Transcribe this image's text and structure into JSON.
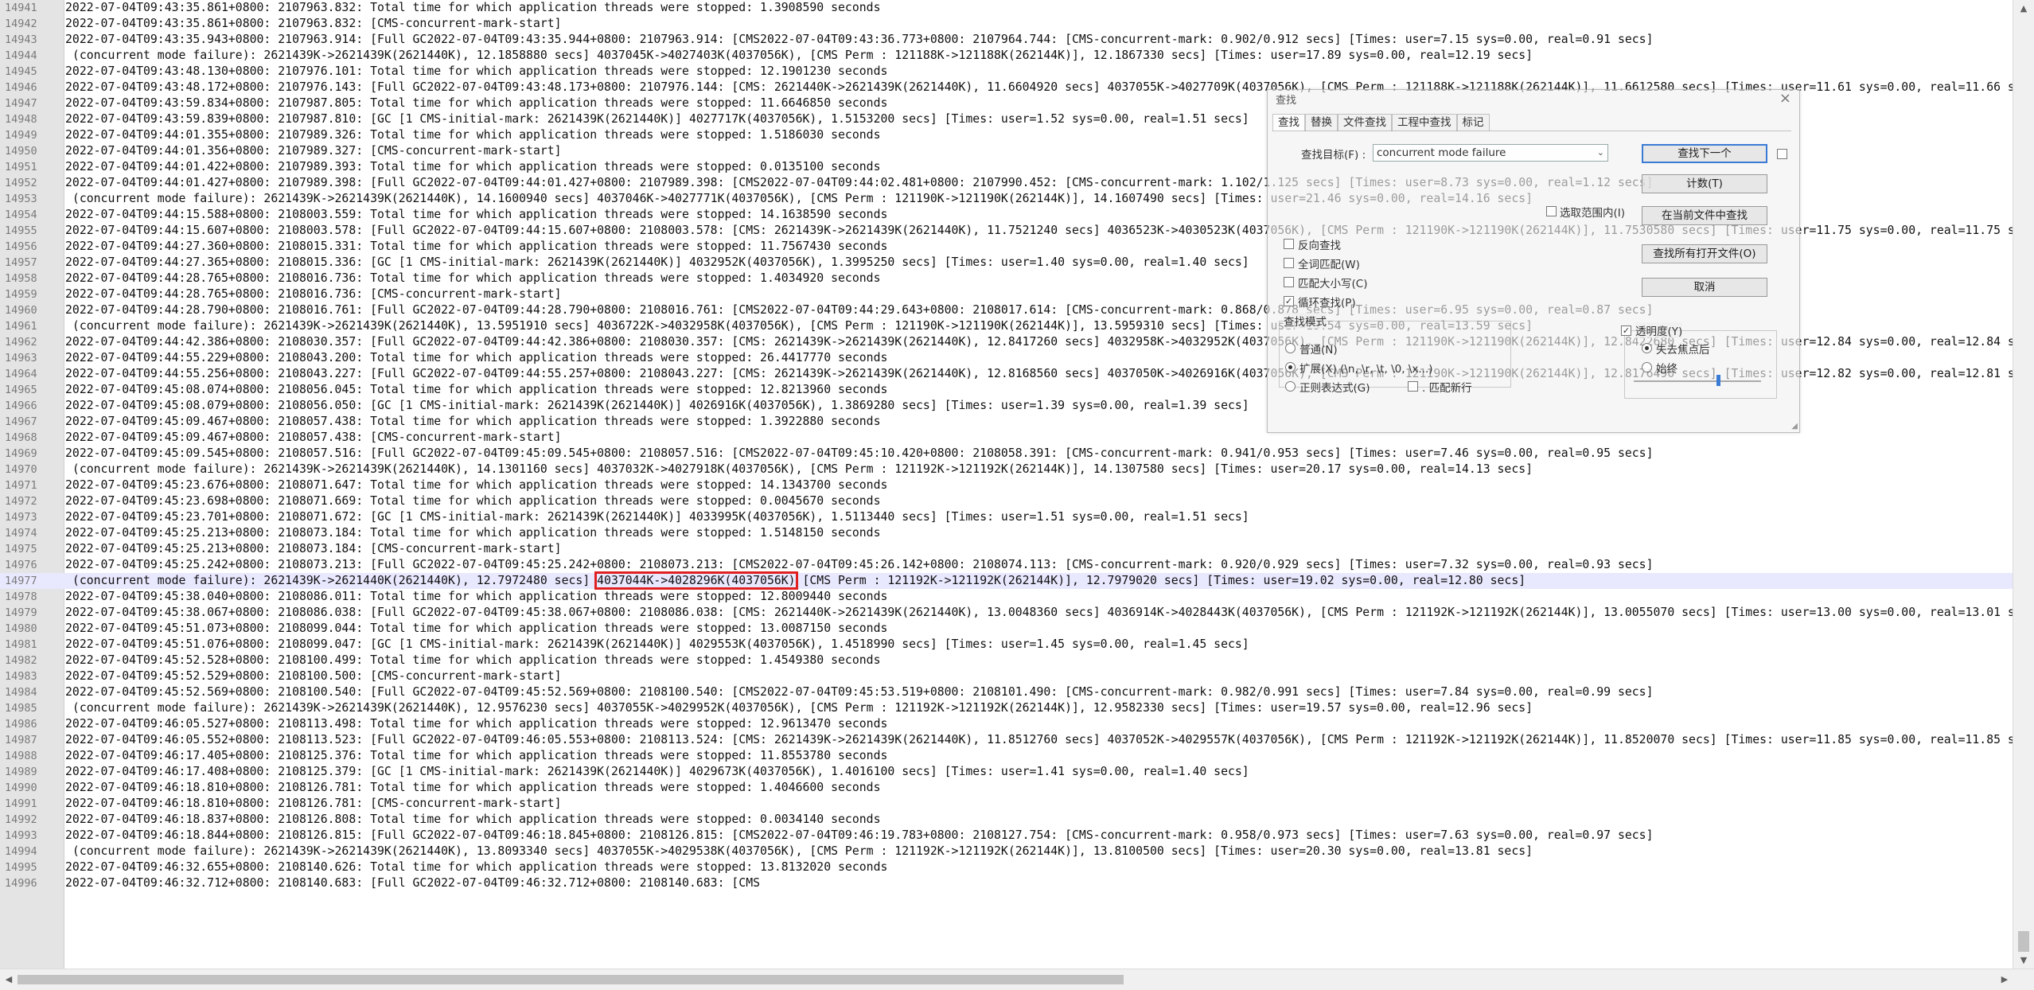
{
  "editor": {
    "highlight_text": "4037044K->4028296K(4037056K)",
    "current_line": "14977",
    "lines": [
      {
        "n": "14941",
        "t": "2022-07-04T09:43:35.861+0800: 2107963.832: Total time for which application threads were stopped: 1.3908590 seconds"
      },
      {
        "n": "14942",
        "t": "2022-07-04T09:43:35.861+0800: 2107963.832: [CMS-concurrent-mark-start]"
      },
      {
        "n": "14943",
        "t": "2022-07-04T09:43:35.943+0800: 2107963.914: [Full GC2022-07-04T09:43:35.944+0800: 2107963.914: [CMS2022-07-04T09:43:36.773+0800: 2107964.744: [CMS-concurrent-mark: 0.902/0.912 secs] [Times: user=7.15 sys=0.00, real=0.91 secs]"
      },
      {
        "n": "14944",
        "t": " (concurrent mode failure): 2621439K->2621439K(2621440K), 12.1858880 secs] 4037045K->4027403K(4037056K), [CMS Perm : 121188K->121188K(262144K)], 12.1867330 secs] [Times: user=17.89 sys=0.00, real=12.19 secs]"
      },
      {
        "n": "14945",
        "t": "2022-07-04T09:43:48.130+0800: 2107976.101: Total time for which application threads were stopped: 12.1901230 seconds"
      },
      {
        "n": "14946",
        "t": "2022-07-04T09:43:48.172+0800: 2107976.143: [Full GC2022-07-04T09:43:48.173+0800: 2107976.144: [CMS: 2621440K->2621439K(2621440K), 11.6604920 secs] 4037055K->4027709K(4037056K), [CMS Perm : 121188K->121188K(262144K)], 11.6612580 secs] [Times: user=11.61 sys=0.00, real=11.66 secs]"
      },
      {
        "n": "14947",
        "t": "2022-07-04T09:43:59.834+0800: 2107987.805: Total time for which application threads were stopped: 11.6646850 seconds"
      },
      {
        "n": "14948",
        "t": "2022-07-04T09:43:59.839+0800: 2107987.810: [GC [1 CMS-initial-mark: 2621439K(2621440K)] 4027717K(4037056K), 1.5153200 secs] [Times: user=1.52 sys=0.00, real=1.51 secs]"
      },
      {
        "n": "14949",
        "t": "2022-07-04T09:44:01.355+0800: 2107989.326: Total time for which application threads were stopped: 1.5186030 seconds"
      },
      {
        "n": "14950",
        "t": "2022-07-04T09:44:01.356+0800: 2107989.327: [CMS-concurrent-mark-start]"
      },
      {
        "n": "14951",
        "t": "2022-07-04T09:44:01.422+0800: 2107989.393: Total time for which application threads were stopped: 0.0135100 seconds"
      },
      {
        "n": "14952",
        "t": "2022-07-04T09:44:01.427+0800: 2107989.398: [Full GC2022-07-04T09:44:01.427+0800: 2107989.398: [CMS2022-07-04T09:44:02.481+0800: 2107990.452: [CMS-concurrent-mark: 1.102/1.125 secs] [Times: user=8.73 sys=0.00, real=1.12 secs]"
      },
      {
        "n": "14953",
        "t": " (concurrent mode failure): 2621439K->2621439K(2621440K), 14.1600940 secs] 4037046K->4027771K(4037056K), [CMS Perm : 121190K->121190K(262144K)], 14.1607490 secs] [Times: user=21.46 sys=0.00, real=14.16 secs]"
      },
      {
        "n": "14954",
        "t": "2022-07-04T09:44:15.588+0800: 2108003.559: Total time for which application threads were stopped: 14.1638590 seconds"
      },
      {
        "n": "14955",
        "t": "2022-07-04T09:44:15.607+0800: 2108003.578: [Full GC2022-07-04T09:44:15.607+0800: 2108003.578: [CMS: 2621439K->2621439K(2621440K), 11.7521240 secs] 4036523K->4030523K(4037056K), [CMS Perm : 121190K->121190K(262144K)], 11.7530580 secs] [Times: user=11.75 sys=0.00, real=11.75 secs]"
      },
      {
        "n": "14956",
        "t": "2022-07-04T09:44:27.360+0800: 2108015.331: Total time for which application threads were stopped: 11.7567430 seconds"
      },
      {
        "n": "14957",
        "t": "2022-07-04T09:44:27.365+0800: 2108015.336: [GC [1 CMS-initial-mark: 2621439K(2621440K)] 4032952K(4037056K), 1.3995250 secs] [Times: user=1.40 sys=0.00, real=1.40 secs]"
      },
      {
        "n": "14958",
        "t": "2022-07-04T09:44:28.765+0800: 2108016.736: Total time for which application threads were stopped: 1.4034920 seconds"
      },
      {
        "n": "14959",
        "t": "2022-07-04T09:44:28.765+0800: 2108016.736: [CMS-concurrent-mark-start]"
      },
      {
        "n": "14960",
        "t": "2022-07-04T09:44:28.790+0800: 2108016.761: [Full GC2022-07-04T09:44:28.790+0800: 2108016.761: [CMS2022-07-04T09:44:29.643+0800: 2108017.614: [CMS-concurrent-mark: 0.868/0.878 secs] [Times: user=6.95 sys=0.00, real=0.87 secs]"
      },
      {
        "n": "14961",
        "t": " (concurrent mode failure): 2621439K->2621439K(2621440K), 13.5951910 secs] 4036722K->4032958K(4037056K), [CMS Perm : 121190K->121190K(262144K)], 13.5959310 secs] [Times: user=19.54 sys=0.00, real=13.59 secs]"
      },
      {
        "n": "14962",
        "t": "2022-07-04T09:44:42.386+0800: 2108030.357: [Full GC2022-07-04T09:44:42.386+0800: 2108030.357: [CMS: 2621439K->2621439K(2621440K), 12.8417260 secs] 4032958K->4032952K(4037056K), [CMS Perm : 121190K->121190K(262144K)], 12.8422680 secs] [Times: user=12.84 sys=0.00, real=12.84 secs]"
      },
      {
        "n": "14963",
        "t": "2022-07-04T09:44:55.229+0800: 2108043.200: Total time for which application threads were stopped: 26.4417770 seconds"
      },
      {
        "n": "14964",
        "t": "2022-07-04T09:44:55.256+0800: 2108043.227: [Full GC2022-07-04T09:44:55.257+0800: 2108043.227: [CMS: 2621439K->2621439K(2621440K), 12.8168560 secs] 4037050K->4026916K(4037056K), [CMS Perm : 121190K->121190K(262144K)], 12.8176490 secs] [Times: user=12.82 sys=0.00, real=12.81 secs]"
      },
      {
        "n": "14965",
        "t": "2022-07-04T09:45:08.074+0800: 2108056.045: Total time for which application threads were stopped: 12.8213960 seconds"
      },
      {
        "n": "14966",
        "t": "2022-07-04T09:45:08.079+0800: 2108056.050: [GC [1 CMS-initial-mark: 2621439K(2621440K)] 4026916K(4037056K), 1.3869280 secs] [Times: user=1.39 sys=0.00, real=1.39 secs]"
      },
      {
        "n": "14967",
        "t": "2022-07-04T09:45:09.467+0800: 2108057.438: Total time for which application threads were stopped: 1.3922880 seconds"
      },
      {
        "n": "14968",
        "t": "2022-07-04T09:45:09.467+0800: 2108057.438: [CMS-concurrent-mark-start]"
      },
      {
        "n": "14969",
        "t": "2022-07-04T09:45:09.545+0800: 2108057.516: [Full GC2022-07-04T09:45:09.545+0800: 2108057.516: [CMS2022-07-04T09:45:10.420+0800: 2108058.391: [CMS-concurrent-mark: 0.941/0.953 secs] [Times: user=7.46 sys=0.00, real=0.95 secs]"
      },
      {
        "n": "14970",
        "t": " (concurrent mode failure): 2621439K->2621439K(2621440K), 14.1301160 secs] 4037032K->4027918K(4037056K), [CMS Perm : 121192K->121192K(262144K)], 14.1307580 secs] [Times: user=20.17 sys=0.00, real=14.13 secs]"
      },
      {
        "n": "14971",
        "t": "2022-07-04T09:45:23.676+0800: 2108071.647: Total time for which application threads were stopped: 14.1343700 seconds"
      },
      {
        "n": "14972",
        "t": "2022-07-04T09:45:23.698+0800: 2108071.669: Total time for which application threads were stopped: 0.0045670 seconds"
      },
      {
        "n": "14973",
        "t": "2022-07-04T09:45:23.701+0800: 2108071.672: [GC [1 CMS-initial-mark: 2621439K(2621440K)] 4033995K(4037056K), 1.5113440 secs] [Times: user=1.51 sys=0.00, real=1.51 secs]"
      },
      {
        "n": "14974",
        "t": "2022-07-04T09:45:25.213+0800: 2108073.184: Total time for which application threads were stopped: 1.5148150 seconds"
      },
      {
        "n": "14975",
        "t": "2022-07-04T09:45:25.213+0800: 2108073.184: [CMS-concurrent-mark-start]"
      },
      {
        "n": "14976",
        "t": "2022-07-04T09:45:25.242+0800: 2108073.213: [Full GC2022-07-04T09:45:25.242+0800: 2108073.213: [CMS2022-07-04T09:45:26.142+0800: 2108074.113: [CMS-concurrent-mark: 0.920/0.929 secs] [Times: user=7.32 sys=0.00, real=0.93 secs]"
      },
      {
        "n": "14977",
        "t": " (concurrent mode failure): 2621439K->2621440K(2621440K), 12.7972480 secs] ",
        "t2": "4037044K->4028296K(4037056K)",
        "t3": " [CMS Perm : 121192K->121192K(262144K)], 12.7979020 secs] [Times: user=19.02 sys=0.00, real=12.80 secs]"
      },
      {
        "n": "14978",
        "t": "2022-07-04T09:45:38.040+0800: 2108086.011: Total time for which application threads were stopped: 12.8009440 seconds"
      },
      {
        "n": "14979",
        "t": "2022-07-04T09:45:38.067+0800: 2108086.038: [Full GC2022-07-04T09:45:38.067+0800: 2108086.038: [CMS: 2621440K->2621439K(2621440K), 13.0048360 secs] 4036914K->4028443K(4037056K), [CMS Perm : 121192K->121192K(262144K)], 13.0055070 secs] [Times: user=13.00 sys=0.00, real=13.01 secs]"
      },
      {
        "n": "14980",
        "t": "2022-07-04T09:45:51.073+0800: 2108099.044: Total time for which application threads were stopped: 13.0087150 seconds"
      },
      {
        "n": "14981",
        "t": "2022-07-04T09:45:51.076+0800: 2108099.047: [GC [1 CMS-initial-mark: 2621439K(2621440K)] 4029553K(4037056K), 1.4518990 secs] [Times: user=1.45 sys=0.00, real=1.45 secs]"
      },
      {
        "n": "14982",
        "t": "2022-07-04T09:45:52.528+0800: 2108100.499: Total time for which application threads were stopped: 1.4549380 seconds"
      },
      {
        "n": "14983",
        "t": "2022-07-04T09:45:52.529+0800: 2108100.500: [CMS-concurrent-mark-start]"
      },
      {
        "n": "14984",
        "t": "2022-07-04T09:45:52.569+0800: 2108100.540: [Full GC2022-07-04T09:45:52.569+0800: 2108100.540: [CMS2022-07-04T09:45:53.519+0800: 2108101.490: [CMS-concurrent-mark: 0.982/0.991 secs] [Times: user=7.84 sys=0.00, real=0.99 secs]"
      },
      {
        "n": "14985",
        "t": " (concurrent mode failure): 2621439K->2621439K(2621440K), 12.9576230 secs] 4037055K->4029952K(4037056K), [CMS Perm : 121192K->121192K(262144K)], 12.9582330 secs] [Times: user=19.57 sys=0.00, real=12.96 secs]"
      },
      {
        "n": "14986",
        "t": "2022-07-04T09:46:05.527+0800: 2108113.498: Total time for which application threads were stopped: 12.9613470 seconds"
      },
      {
        "n": "14987",
        "t": "2022-07-04T09:46:05.552+0800: 2108113.523: [Full GC2022-07-04T09:46:05.553+0800: 2108113.524: [CMS: 2621439K->2621439K(2621440K), 11.8512760 secs] 4037052K->4029557K(4037056K), [CMS Perm : 121192K->121192K(262144K)], 11.8520070 secs] [Times: user=11.85 sys=0.00, real=11.85 secs]"
      },
      {
        "n": "14988",
        "t": "2022-07-04T09:46:17.405+0800: 2108125.376: Total time for which application threads were stopped: 11.8553780 seconds"
      },
      {
        "n": "14989",
        "t": "2022-07-04T09:46:17.408+0800: 2108125.379: [GC [1 CMS-initial-mark: 2621439K(2621440K)] 4029673K(4037056K), 1.4016100 secs] [Times: user=1.41 sys=0.00, real=1.40 secs]"
      },
      {
        "n": "14990",
        "t": "2022-07-04T09:46:18.810+0800: 2108126.781: Total time for which application threads were stopped: 1.4046600 seconds"
      },
      {
        "n": "14991",
        "t": "2022-07-04T09:46:18.810+0800: 2108126.781: [CMS-concurrent-mark-start]"
      },
      {
        "n": "14992",
        "t": "2022-07-04T09:46:18.837+0800: 2108126.808: Total time for which application threads were stopped: 0.0034140 seconds"
      },
      {
        "n": "14993",
        "t": "2022-07-04T09:46:18.844+0800: 2108126.815: [Full GC2022-07-04T09:46:18.845+0800: 2108126.815: [CMS2022-07-04T09:46:19.783+0800: 2108127.754: [CMS-concurrent-mark: 0.958/0.973 secs] [Times: user=7.63 sys=0.00, real=0.97 secs]"
      },
      {
        "n": "14994",
        "t": " (concurrent mode failure): 2621439K->2621439K(2621440K), 13.8093340 secs] 4037055K->4029538K(4037056K), [CMS Perm : 121192K->121192K(262144K)], 13.8100500 secs] [Times: user=20.30 sys=0.00, real=13.81 secs]"
      },
      {
        "n": "14995",
        "t": "2022-07-04T09:46:32.655+0800: 2108140.626: Total time for which application threads were stopped: 13.8132020 seconds"
      },
      {
        "n": "14996",
        "t": "2022-07-04T09:46:32.712+0800: 2108140.683: [Full GC2022-07-04T09:46:32.712+0800: 2108140.683: [CMS"
      }
    ]
  },
  "scrollbars": {
    "up_icon": "▲",
    "down_icon": "▼",
    "left_icon": "◀",
    "right_icon": "▶"
  },
  "find_dialog": {
    "title": "查找",
    "close_icon": "×",
    "tabs": [
      "查找",
      "替换",
      "文件查找",
      "工程中查找",
      "标记"
    ],
    "find_label": "查找目标(F) :",
    "find_value": "concurrent mode failure",
    "find_next": "查找下一个",
    "count": "计数(T)",
    "find_in_current": "在当前文件中查找",
    "find_in_all_open": "查找所有打开文件(O)",
    "cancel": "取消",
    "in_selection": "选取范围内(I)",
    "backward": "反向查找",
    "whole_word": "全词匹配(W)",
    "match_case": "匹配大小写(C)",
    "wrap": "循环查找(P)",
    "search_mode": "查找模式",
    "mode_normal": "普通(N)",
    "mode_extended": "扩展(X) (\\n, \\r, \\t, \\0, \\x...)",
    "mode_regex": "正则表达式(G)",
    "dot_newline": ". 匹配新行",
    "transparency": "透明度(Y)",
    "on_lose_focus": "失去焦点后",
    "always": "始终"
  }
}
